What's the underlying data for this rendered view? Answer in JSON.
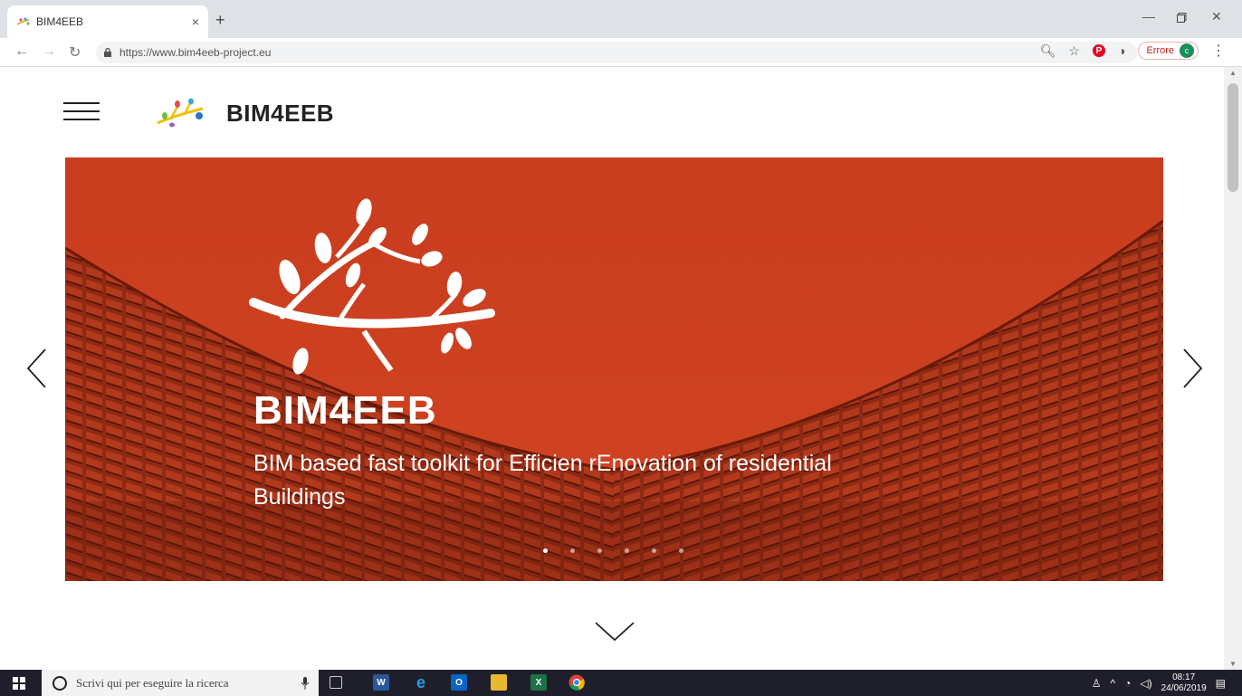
{
  "browser": {
    "tab_title": "BIM4EEB",
    "tab_close": "×",
    "new_tab": "+",
    "url": "https://www.bim4eeb-project.eu",
    "error_label": "Errore",
    "avatar_letter": "c",
    "pinterest_glyph": "P"
  },
  "site": {
    "brand": "BIM4EEB"
  },
  "hero": {
    "title": "BIM4EEB",
    "subtitle": "BIM based fast toolkit for Efficien rEnovation of residential Buildings",
    "accent_color": "#c33f20",
    "slide_count": 6,
    "active_slide": 1
  },
  "taskbar": {
    "search_placeholder": "Scrivi qui per eseguire la ricerca",
    "time": "08:17",
    "date": "24/06/2019"
  }
}
